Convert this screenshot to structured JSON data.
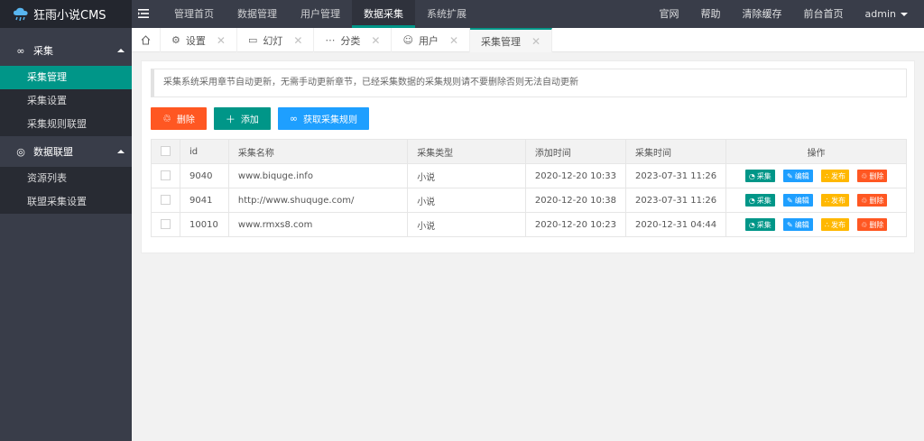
{
  "app": {
    "title": "狂雨小说CMS"
  },
  "topnav": {
    "items": [
      {
        "label": "管理首页",
        "active": false
      },
      {
        "label": "数据管理",
        "active": false
      },
      {
        "label": "用户管理",
        "active": false
      },
      {
        "label": "数据采集",
        "active": true
      },
      {
        "label": "系统扩展",
        "active": false
      }
    ],
    "right": [
      {
        "label": "官网"
      },
      {
        "label": "帮助"
      },
      {
        "label": "清除缓存"
      },
      {
        "label": "前台首页"
      },
      {
        "label": "admin"
      }
    ]
  },
  "sidebar": {
    "groups": [
      {
        "title": "采集",
        "icon": "link-icon",
        "items": [
          "采集管理",
          "采集设置",
          "采集规则联盟"
        ]
      },
      {
        "title": "数据联盟",
        "icon": "globe-icon",
        "items": [
          "资源列表",
          "联盟采集设置"
        ]
      }
    ],
    "active_item": "采集管理"
  },
  "tabs": {
    "items": [
      {
        "label": "设置",
        "icon": "gear-icon"
      },
      {
        "label": "幻灯",
        "icon": "slides-icon"
      },
      {
        "label": "分类",
        "icon": "more-icon"
      },
      {
        "label": "用户",
        "icon": "user-icon"
      },
      {
        "label": "采集管理",
        "icon": "",
        "active": true
      }
    ]
  },
  "notice": "采集系统采用章节自动更新，无需手动更新章节，已经采集数据的采集规则请不要删除否则无法自动更新",
  "toolbar": {
    "delete_label": "删除",
    "add_label": "添加",
    "fetch_label": "获取采集规则"
  },
  "table": {
    "columns": [
      "id",
      "采集名称",
      "采集类型",
      "添加时间",
      "采集时间",
      "操作"
    ],
    "rows": [
      {
        "id": "9040",
        "name": "www.biquge.info",
        "type": "小说",
        "added": "2020-12-20 10:33",
        "collected": "2023-07-31 11:26"
      },
      {
        "id": "9041",
        "name": "http://www.shuquge.com/",
        "type": "小说",
        "added": "2020-12-20 10:38",
        "collected": "2023-07-31 11:26"
      },
      {
        "id": "10010",
        "name": "www.rmxs8.com",
        "type": "小说",
        "added": "2020-12-20 10:23",
        "collected": "2020-12-31 04:44"
      }
    ],
    "actions": {
      "collect": "采集",
      "edit": "编辑",
      "publish": "发布",
      "delete": "删除"
    }
  },
  "colors": {
    "accent": "#009688",
    "danger": "#ff5722",
    "info": "#1e9fff",
    "warn": "#ffb800",
    "topbar": "#393d49"
  }
}
